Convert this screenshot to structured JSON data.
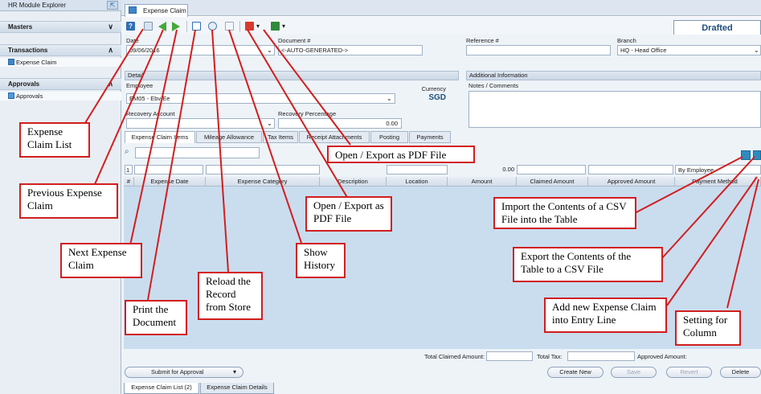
{
  "explorer": {
    "title": "HR Module Explorer",
    "sections": [
      {
        "label": "Masters",
        "chevron": "∨"
      },
      {
        "label": "Transactions",
        "chevron": "∧",
        "items": [
          "Expense Claim"
        ]
      },
      {
        "label": "Approvals",
        "chevron": "∧",
        "items": [
          "Approvals"
        ]
      }
    ]
  },
  "tab": {
    "label": "Expense Claim",
    "close": "×"
  },
  "status": "Drafted",
  "fields": {
    "date_label": "Date",
    "date_value": "09/06/2016",
    "document_label": "Document #",
    "document_value": "<-AUTO-GENERATED->",
    "reference_label": "Reference #",
    "reference_value": "",
    "branch_label": "Branch",
    "branch_value": "HQ - Head Office"
  },
  "detail": {
    "header": "Detail",
    "employee_label": "Employee",
    "employee_value": "EM05 - Ebv Ee",
    "currency_label": "Currency",
    "currency_value": "SGD",
    "recovery_account_label": "Recovery Account",
    "recovery_percentage_label": "Recovery Percentage",
    "recovery_percentage_value": "0.00"
  },
  "additional": {
    "header": "Additional Information",
    "notes_label": "Notes / Comments"
  },
  "subtabs": [
    "Expense Claim Items",
    "Mileage Allowance",
    "Tax Items",
    "Receipt Attachments",
    "Posting",
    "Payments"
  ],
  "filter": {
    "row_number": "1",
    "amount": "0.00",
    "group_by": "By Employee"
  },
  "columns": [
    "#",
    "Expense Date",
    "Expense Category",
    "Description",
    "Location",
    "Amount",
    "Claimed Amount",
    "Approved Amount",
    "Payment Method"
  ],
  "totals": {
    "claimed_label": "Total Claimed Amount:",
    "tax_label": "Total Tax:",
    "approved_label": "Approved Amount:"
  },
  "buttons": {
    "submit": "Submit for Approval",
    "create_new": "Create New",
    "save": "Save",
    "revert": "Revert",
    "delete": "Delete"
  },
  "bottom_tabs": [
    "Expense Claim List (2)",
    "Expense Claim Details"
  ],
  "annotations": {
    "expense_claim_list": "Expense Claim List",
    "previous": "Previous Expense Claim",
    "next": "Next Expense Claim",
    "print": "Print the Document",
    "reload": "Reload the Record from Store",
    "show_history": "Show History",
    "pdf_toolbar": "Open / Export as PDF File",
    "pdf_top": "Open / Export as PDF File",
    "import_csv": "Import the Contents of a CSV File into the Table",
    "export_csv": "Export the Contents of the Table to a CSV File",
    "add_line": "Add new Expense Claim into Entry Line",
    "setting_column": "Setting for Column"
  },
  "colors": {
    "annotation_border": "#d21e1e",
    "accent": "#2b6aa3",
    "grid_bg": "#c9ddef"
  }
}
